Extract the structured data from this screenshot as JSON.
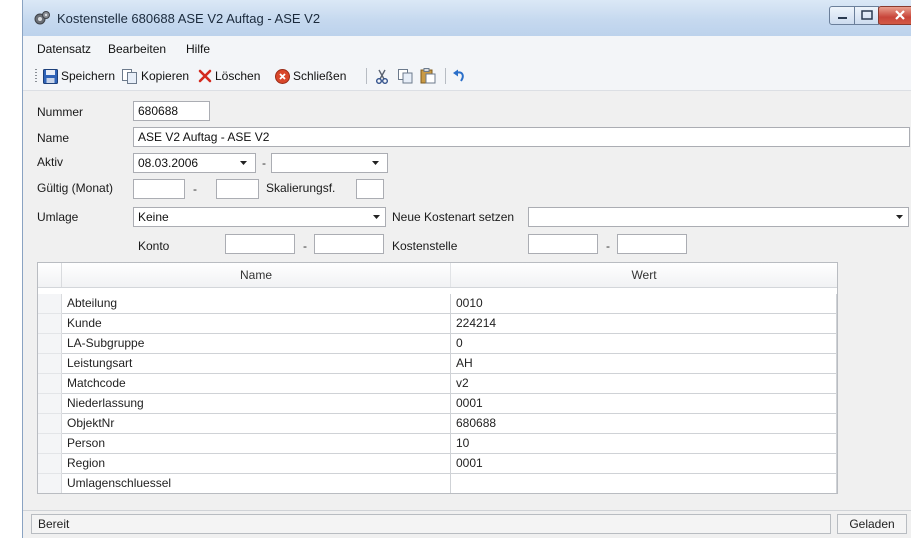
{
  "window": {
    "title": "Kostenstelle 680688 ASE V2 Auftag - ASE V2"
  },
  "menu": [
    "Datensatz",
    "Bearbeiten",
    "Hilfe"
  ],
  "toolbar": {
    "save_label": "Speichern",
    "copy_label": "Kopieren",
    "delete_label": "Löschen",
    "close_label": "Schließen"
  },
  "form": {
    "nummer_label": "Nummer",
    "nummer_value": "680688",
    "name_label": "Name",
    "name_value": "ASE V2 Auftag - ASE V2",
    "aktiv_label": "Aktiv",
    "aktiv_from": "08.03.2006",
    "aktiv_to": "",
    "dash": "-",
    "gueltig_label": "Gültig (Monat)",
    "gueltig_from": "",
    "gueltig_to": "",
    "skalierung_label": "Skalierungsf.",
    "skalierung_value": "",
    "umlage_label": "Umlage",
    "umlage_value": "Keine",
    "kostenart_label": "Neue Kostenart setzen",
    "kostenart_value": "",
    "konto_label": "Konto",
    "konto_from": "",
    "konto_to": "",
    "kostenstelle_label": "Kostenstelle",
    "kostenstelle_from": "",
    "kostenstelle_to": ""
  },
  "grid": {
    "columns": [
      "Name",
      "Wert"
    ],
    "rows": [
      {
        "name": "Abteilung",
        "wert": "0010"
      },
      {
        "name": "Kunde",
        "wert": "224214"
      },
      {
        "name": "LA-Subgruppe",
        "wert": "0"
      },
      {
        "name": "Leistungsart",
        "wert": "AH"
      },
      {
        "name": "Matchcode",
        "wert": "v2"
      },
      {
        "name": "Niederlassung",
        "wert": "0001"
      },
      {
        "name": "ObjektNr",
        "wert": "680688"
      },
      {
        "name": "Person",
        "wert": "10"
      },
      {
        "name": "Region",
        "wert": "0001"
      },
      {
        "name": "Umlagenschluessel",
        "wert": ""
      }
    ]
  },
  "status": {
    "left": "Bereit",
    "right": "Geladen"
  },
  "icons": {
    "app": "gears-icon",
    "save": "floppy-disk-icon",
    "copy": "copy-icon",
    "delete": "red-x-icon",
    "close": "red-circle-x-icon",
    "cut": "scissors-icon",
    "paste-copy": "copy-small-icon",
    "paste": "clipboard-icon",
    "undo": "undo-arrow-icon"
  },
  "colors": {
    "titlebar": "#c6d9ef",
    "close_button": "#c8453a",
    "delete_icon": "#d42a1e",
    "undo_icon": "#2b6fc9"
  }
}
